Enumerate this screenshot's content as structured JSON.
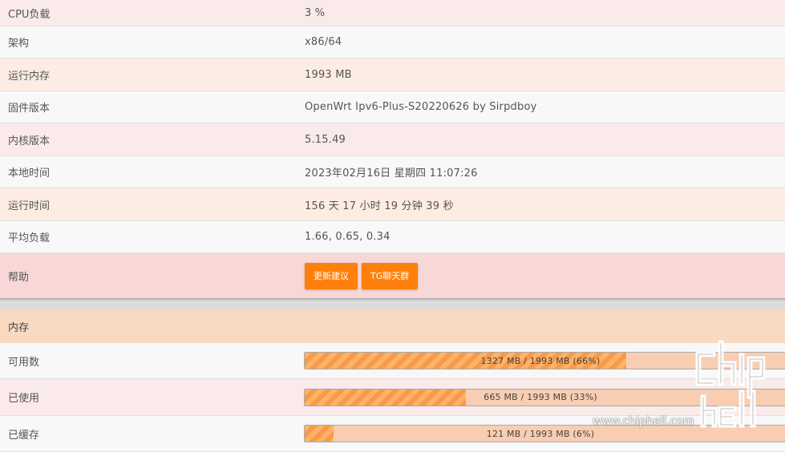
{
  "status_rows": [
    {
      "label": "CPU负载",
      "value": "3 %"
    },
    {
      "label": "架构",
      "value": "x86/64"
    },
    {
      "label": "运行内存",
      "value": "1993 MB"
    },
    {
      "label": "固件版本",
      "value": "OpenWrt Ipv6-Plus-S20220626 by Sirpdboy"
    },
    {
      "label": "内核版本",
      "value": "5.15.49"
    },
    {
      "label": "本地时间",
      "value": "2023年02月16日 星期四 11:07:26"
    },
    {
      "label": "运行时间",
      "value": "156 天 17 小时 19 分钟 39 秒"
    },
    {
      "label": "平均负载",
      "value": "1.66, 0.65, 0.34"
    }
  ],
  "help": {
    "label": "帮助",
    "buttons": [
      "更新建议",
      "TG聊天群"
    ]
  },
  "memory": {
    "title": "内存",
    "rows": [
      {
        "label": "可用数",
        "text": "1327 MB / 1993 MB (66%)",
        "percent": 66
      },
      {
        "label": "已使用",
        "text": "665 MB / 1993 MB (33%)",
        "percent": 33
      },
      {
        "label": "已缓存",
        "text": "121 MB / 1993 MB (6%)",
        "percent": 6
      }
    ]
  },
  "colors": {
    "accent": "#ff7f0c",
    "bar_bg": "#f8cdb2",
    "stripe_a": "#ffb36a",
    "stripe_b": "#f89a48"
  },
  "watermark": {
    "text": "www.chiphell.com"
  }
}
